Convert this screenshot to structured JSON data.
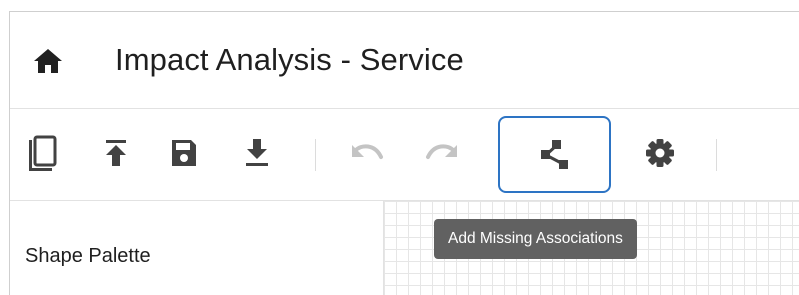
{
  "header": {
    "title": "Impact Analysis - Service",
    "home_icon": "home-icon"
  },
  "toolbar": {
    "buttons": [
      {
        "icon": "copy-icon",
        "state": "enabled"
      },
      {
        "icon": "upload-icon",
        "state": "enabled"
      },
      {
        "icon": "save-icon",
        "state": "enabled"
      },
      {
        "icon": "download-icon",
        "state": "enabled"
      },
      {
        "icon": "undo-icon",
        "state": "disabled"
      },
      {
        "icon": "redo-icon",
        "state": "disabled"
      },
      {
        "icon": "add-associations-icon",
        "state": "focused"
      },
      {
        "icon": "settings-icon",
        "state": "enabled"
      }
    ]
  },
  "tooltip": {
    "text": "Add Missing Associations"
  },
  "palette": {
    "title": "Shape Palette"
  },
  "colors": {
    "icon": "#424242",
    "icon_disabled": "#c4c4c4",
    "focus_border": "#2d74c4",
    "tooltip_bg": "#616161",
    "grid_line": "#e6e6e6"
  }
}
